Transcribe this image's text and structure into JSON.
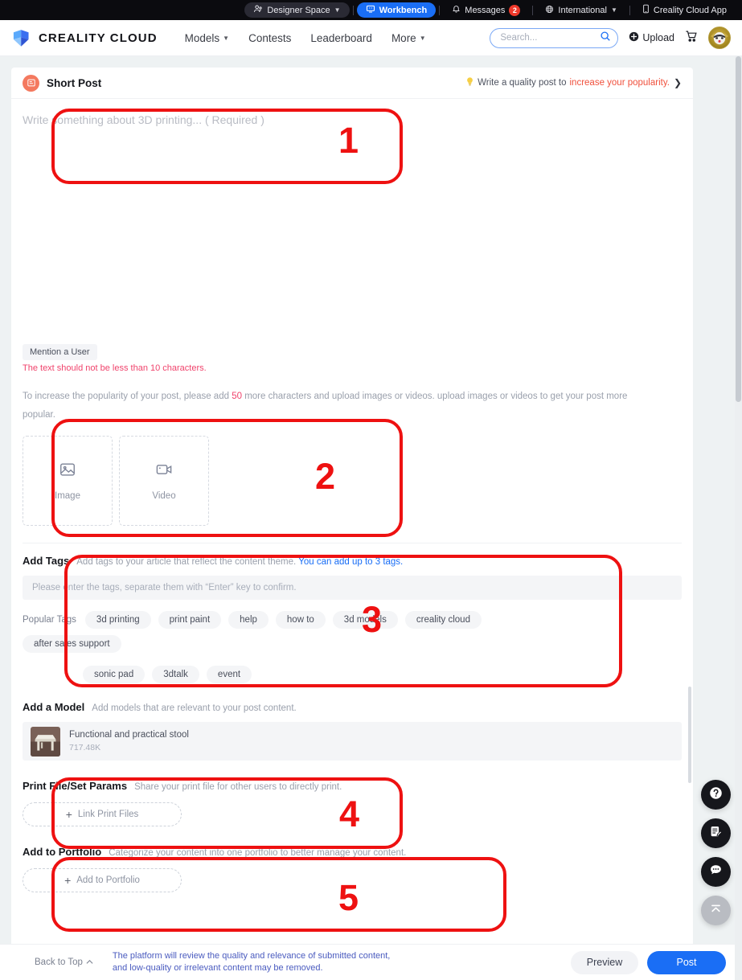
{
  "topbar": {
    "designer_space": "Designer Space",
    "workbench": "Workbench",
    "messages": "Messages",
    "messages_count": "2",
    "international": "International",
    "app": "Creality Cloud App"
  },
  "nav": {
    "brand": "CREALITY CLOUD",
    "links": [
      {
        "label": "Models",
        "caret": true
      },
      {
        "label": "Contests",
        "caret": false
      },
      {
        "label": "Leaderboard",
        "caret": false
      },
      {
        "label": "More",
        "caret": true
      }
    ],
    "search_placeholder": "Search...",
    "search_value": "",
    "upload": "Upload"
  },
  "card": {
    "title": "Short Post",
    "quality_prefix": "Write a quality post to",
    "quality_link": "increase your popularity.",
    "quality_arrow": "❯"
  },
  "editor": {
    "placeholder": "Write something about 3D printing... ( Required )",
    "value": "",
    "mention_chip": "Mention a User",
    "error": "The text should not be less than 10 characters.",
    "hint_pre": "To increase the popularity of your post, please add",
    "hint_num": "50",
    "hint_post": "more characters and upload images or videos. upload images or videos to get your post more popular."
  },
  "media": {
    "image_label": "Image",
    "video_label": "Video"
  },
  "tags": {
    "title": "Add Tags",
    "desc": "Add tags to your article that reflect the content theme.",
    "desc_link": "You can add up to 3 tags.",
    "input_placeholder": "Please enter the tags, separate them with “Enter” key to confirm.",
    "input_value": "",
    "popular_label": "Popular Tags",
    "popular": [
      "3d printing",
      "print paint",
      "help",
      "how to",
      "3d models",
      "creality cloud",
      "after sales support",
      "sonic pad",
      "3dtalk",
      "event"
    ]
  },
  "model": {
    "title": "Add a Model",
    "desc": "Add models that are relevant to your post content.",
    "item_name": "Functional and practical stool",
    "item_size": "717.48K"
  },
  "printfile": {
    "title": "Print File/Set Params",
    "desc": "Share your print file for other users to directly print.",
    "button": "Link Print Files"
  },
  "portfolio": {
    "title": "Add to Portfolio",
    "desc": "Categorize your content into one portfolio to better manage your content.",
    "button": "Add to Portfolio"
  },
  "footer": {
    "back_to_top": "Back to Top",
    "note_line1": "The platform will review the quality and relevance of submitted content,",
    "note_line2": "and low-quality or irrelevant content may be removed.",
    "preview": "Preview",
    "post": "Post"
  },
  "fabs": [
    {
      "name": "help-icon"
    },
    {
      "name": "feedback-icon"
    },
    {
      "name": "chat-icon"
    },
    {
      "name": "scroll-top-icon"
    }
  ],
  "annotations": [
    {
      "label": "1"
    },
    {
      "label": "2"
    },
    {
      "label": "3"
    },
    {
      "label": "4"
    },
    {
      "label": "5"
    }
  ],
  "colors": {
    "accent_blue": "#1a6ef5",
    "error_red": "#f0436c",
    "annotation_red": "#ee1111",
    "link_orange": "#f0503c"
  }
}
